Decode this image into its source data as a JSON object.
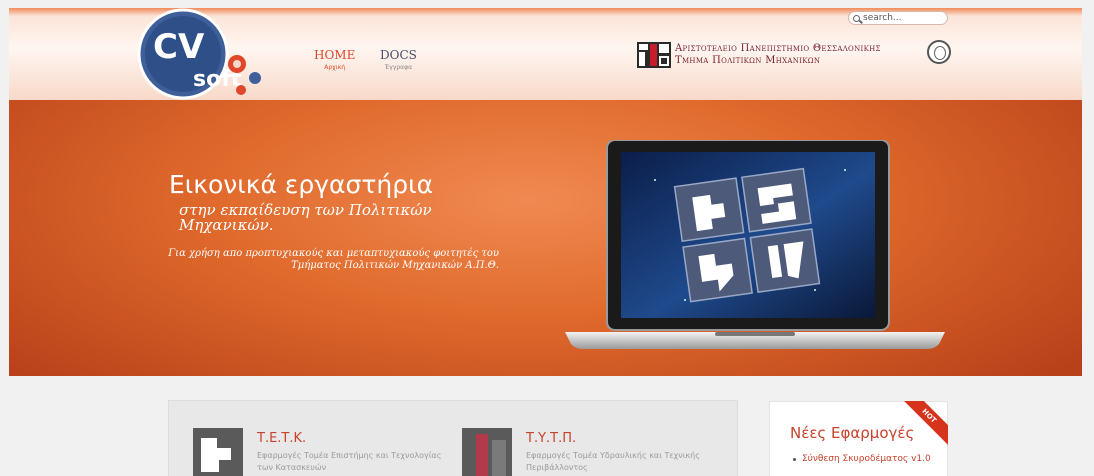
{
  "search": {
    "placeholder": "search..."
  },
  "logo": {
    "text_top": "CV",
    "text_bottom": "soft"
  },
  "nav": [
    {
      "label": "HOME",
      "sublabel": "Αρχική"
    },
    {
      "label": "DOCS",
      "sublabel": "Έγγραφα"
    }
  ],
  "university": {
    "line1": "Αριστοτελειο Πανεπιστημιο Θεσσαλονικης",
    "line2": "Τμημα Πολιτικων Μηχανικων"
  },
  "hero": {
    "title": "Εικονικά εργαστήρια",
    "subtitle": "στην εκπαίδευση των Πολιτικών Μηχανικών.",
    "description": "Για χρήση απο προπτυχιακούς και μεταπτυχιακούς φοιτητές του Τμήματος Πολιτικών Μηχανικών Α.Π.Θ."
  },
  "cards": [
    {
      "title": "Τ.Ε.Τ.Κ.",
      "text": "Εφαρμογές Τομέα Επιστήμης και Τεχνολογίας των Κατασκευών",
      "icon": "tetk-icon"
    },
    {
      "title": "Τ.Υ.Τ.Π.",
      "text": "Εφαρμογές Τομέα Υδραυλικής και Τεχνικής Περιβάλλοντος",
      "icon": "tytp-icon"
    }
  ],
  "sidebar": {
    "title": "Νέες Εφαρμογές",
    "badge": "HOT",
    "items": [
      {
        "label": "Σύνθεση Σκυροδέματος v1.0"
      }
    ]
  },
  "colors": {
    "accent": "#c8412a",
    "hero": "#e06a2c",
    "nav_active": "#e0462a"
  }
}
